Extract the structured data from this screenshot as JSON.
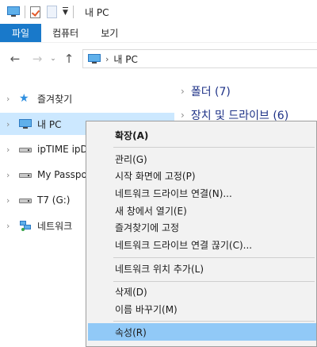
{
  "window": {
    "title": "내 PC"
  },
  "ribbon": {
    "tabs": [
      {
        "label": "파일",
        "active": true
      },
      {
        "label": "컴퓨터",
        "active": false
      },
      {
        "label": "보기",
        "active": false
      }
    ]
  },
  "address": {
    "breadcrumb": "내 PC"
  },
  "nav": {
    "items": [
      {
        "label": "즐겨찾기",
        "icon": "star-icon"
      },
      {
        "label": "내 PC",
        "icon": "pc-icon",
        "selected": true
      },
      {
        "label": "ipTIME ipDISK",
        "icon": "drive-icon"
      },
      {
        "label": "My Passport",
        "icon": "drive-icon"
      },
      {
        "label": "T7 (G:)",
        "icon": "drive-icon"
      },
      {
        "label": "네트워크",
        "icon": "network-icon"
      }
    ]
  },
  "content": {
    "groups": [
      {
        "title": "폴더 (7)"
      },
      {
        "title": "장치 및 드라이브 (6)"
      }
    ]
  },
  "context_menu": {
    "items": [
      {
        "label": "확장(A)",
        "bold": true
      },
      {
        "label": "관리(G)"
      },
      {
        "label": "시작 화면에 고정(P)"
      },
      {
        "label": "네트워크 드라이브 연결(N)..."
      },
      {
        "label": "새 창에서 열기(E)"
      },
      {
        "label": "즐겨찾기에 고정"
      },
      {
        "label": "네트워크 드라이브 연결 끊기(C)..."
      },
      {
        "label": "네트워크 위치 추가(L)"
      },
      {
        "label": "삭제(D)"
      },
      {
        "label": "이름 바꾸기(M)"
      },
      {
        "label": "속성(R)",
        "highlighted": true
      }
    ]
  },
  "colors": {
    "accent": "#1979ca",
    "selection": "#cce8ff",
    "menu_highlight": "#91c9f7",
    "group_title": "#1e3287"
  }
}
